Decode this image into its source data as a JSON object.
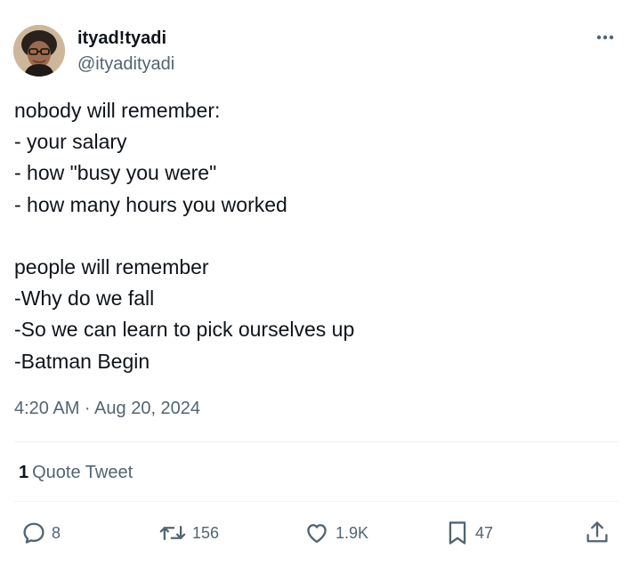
{
  "author": {
    "display_name": "ityad!tyadi",
    "handle": "@ityadityadi"
  },
  "tweet": {
    "lines": [
      "nobody will remember:",
      "- your salary",
      "- how \"busy you were\"",
      "- how many hours you worked",
      "",
      "people will remember",
      "-Why do we fall",
      "-So we can learn to pick ourselves up",
      "-Batman Begin"
    ],
    "timestamp": "4:20 AM · Aug 20, 2024"
  },
  "quotes": {
    "count": "1",
    "label": "Quote Tweet"
  },
  "actions": {
    "replies": "8",
    "retweets": "156",
    "likes": "1.9K",
    "bookmarks": "47"
  },
  "icons": {
    "more": "more-horizontal-icon",
    "reply": "reply-icon",
    "retweet": "retweet-icon",
    "like": "heart-icon",
    "bookmark": "bookmark-icon",
    "share": "share-icon"
  },
  "colors": {
    "text_primary": "#0f1419",
    "text_secondary": "#536471",
    "divider": "#eff3f4"
  }
}
